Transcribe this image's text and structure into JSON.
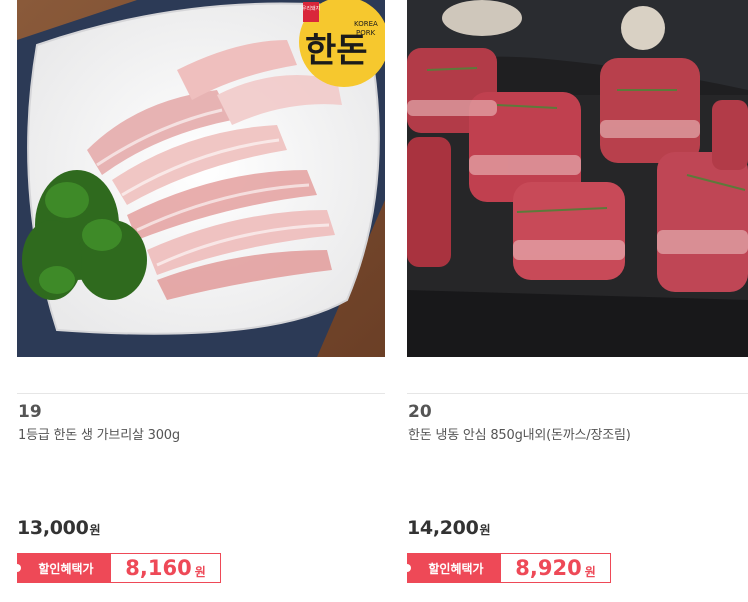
{
  "products": [
    {
      "number": "19",
      "name": "1등급 한돈 생 가브리살 300g",
      "price": "13,000",
      "currency": "원",
      "sale_label": "할인혜택가",
      "sale_price": "8,160",
      "logo": {
        "main_text": "한돈",
        "sub_text_1": "KOREA",
        "sub_text_2": "PORK",
        "stamp_text": "우리돼지"
      }
    },
    {
      "number": "20",
      "name": "한돈 냉동 안심 850g내외(돈까스/장조림)",
      "price": "14,200",
      "currency": "원",
      "sale_label": "할인혜택가",
      "sale_price": "8,920"
    }
  ],
  "colors": {
    "sale_accent": "#ee4957",
    "text_dark": "#333333",
    "text_muted": "#555555"
  }
}
